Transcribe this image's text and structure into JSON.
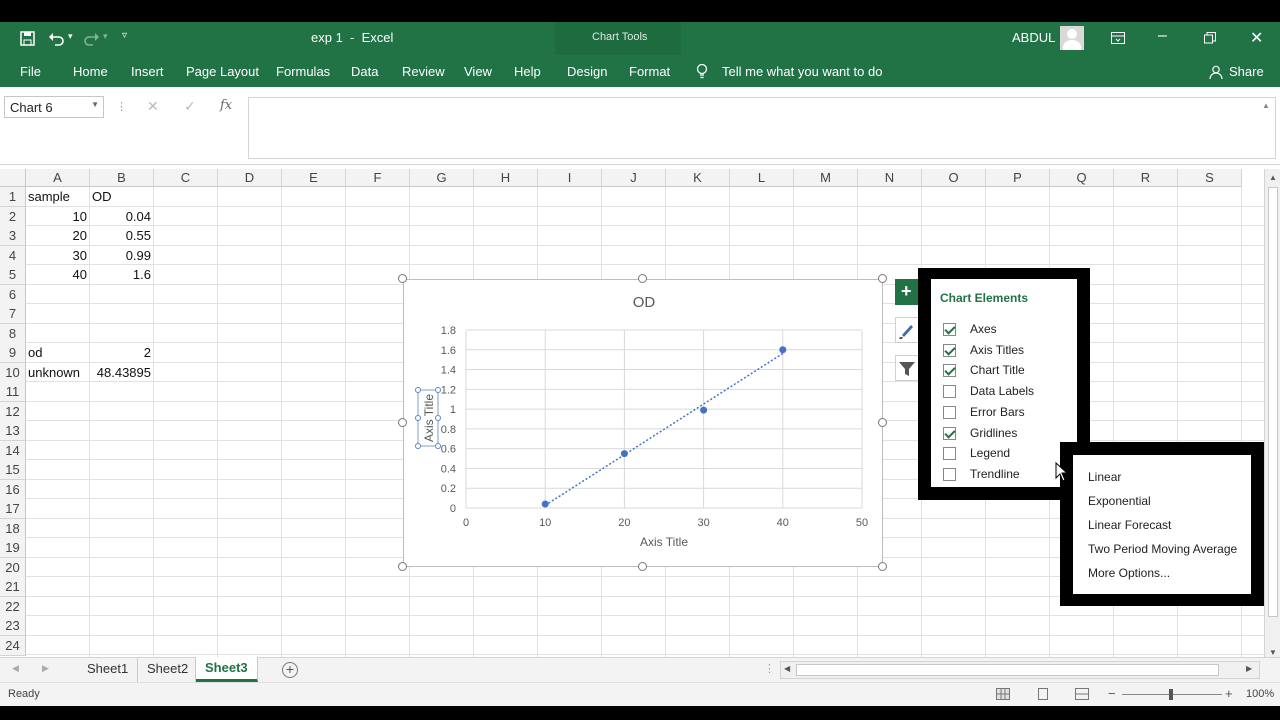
{
  "titlebar": {
    "file_title": "exp 1  -  Excel",
    "context_label": "Chart Tools",
    "user": "ABDUL"
  },
  "ribbon_tabs": [
    "File",
    "Home",
    "Insert",
    "Page Layout",
    "Formulas",
    "Data",
    "Review",
    "View",
    "Help",
    "Design",
    "Format"
  ],
  "tell_me": "Tell me what you want to do",
  "share": "Share",
  "namebox": {
    "value": "Chart 6"
  },
  "formula_bar": {
    "fx": "fx",
    "value": ""
  },
  "columns": [
    "A",
    "B",
    "C",
    "D",
    "E",
    "F",
    "G",
    "H",
    "I",
    "J",
    "K",
    "L",
    "M",
    "N",
    "O",
    "P",
    "Q",
    "R",
    "S"
  ],
  "rows": [
    "1",
    "2",
    "3",
    "4",
    "5",
    "6",
    "7",
    "8",
    "9",
    "10",
    "11",
    "12",
    "13",
    "14",
    "15",
    "16",
    "17",
    "18",
    "19",
    "20",
    "21",
    "22",
    "23",
    "24"
  ],
  "cells": {
    "A1": "sample",
    "B1": "OD",
    "A2": "10",
    "B2": "0.04",
    "A3": "20",
    "B3": "0.55",
    "A4": "30",
    "B4": "0.99",
    "A5": "40",
    "B5": "1.6",
    "A9": "od",
    "B9": "2",
    "A10": "unknown",
    "B10": "48.43895"
  },
  "chart_data": {
    "type": "scatter",
    "title": "OD",
    "xlabel": "Axis Title",
    "ylabel": "Axis Title",
    "x": [
      10,
      20,
      30,
      40
    ],
    "y": [
      0.04,
      0.55,
      0.99,
      1.6
    ],
    "xlim": [
      0,
      50
    ],
    "ylim": [
      0,
      1.8
    ],
    "xticks": [
      "0",
      "10",
      "20",
      "30",
      "40",
      "50"
    ],
    "yticks": [
      "0",
      "0.2",
      "0.4",
      "0.6",
      "0.8",
      "1",
      "1.2",
      "1.4",
      "1.6",
      "1.8"
    ],
    "grid": true,
    "trendline": "linear",
    "series_color": "#4472c4"
  },
  "chart_elements": {
    "title": "Chart Elements",
    "items": [
      {
        "label": "Axes",
        "checked": true
      },
      {
        "label": "Axis Titles",
        "checked": true
      },
      {
        "label": "Chart Title",
        "checked": true
      },
      {
        "label": "Data Labels",
        "checked": false
      },
      {
        "label": "Error Bars",
        "checked": false
      },
      {
        "label": "Gridlines",
        "checked": true
      },
      {
        "label": "Legend",
        "checked": false
      },
      {
        "label": "Trendline",
        "checked": false
      }
    ]
  },
  "trendline_menu": [
    "Linear",
    "Exponential",
    "Linear Forecast",
    "Two Period Moving Average",
    "More Options..."
  ],
  "sheets": [
    "Sheet1",
    "Sheet2",
    "Sheet3"
  ],
  "active_sheet": "Sheet3",
  "status": {
    "ready": "Ready",
    "zoom": "100%"
  },
  "colors": {
    "accent": "#217346"
  }
}
